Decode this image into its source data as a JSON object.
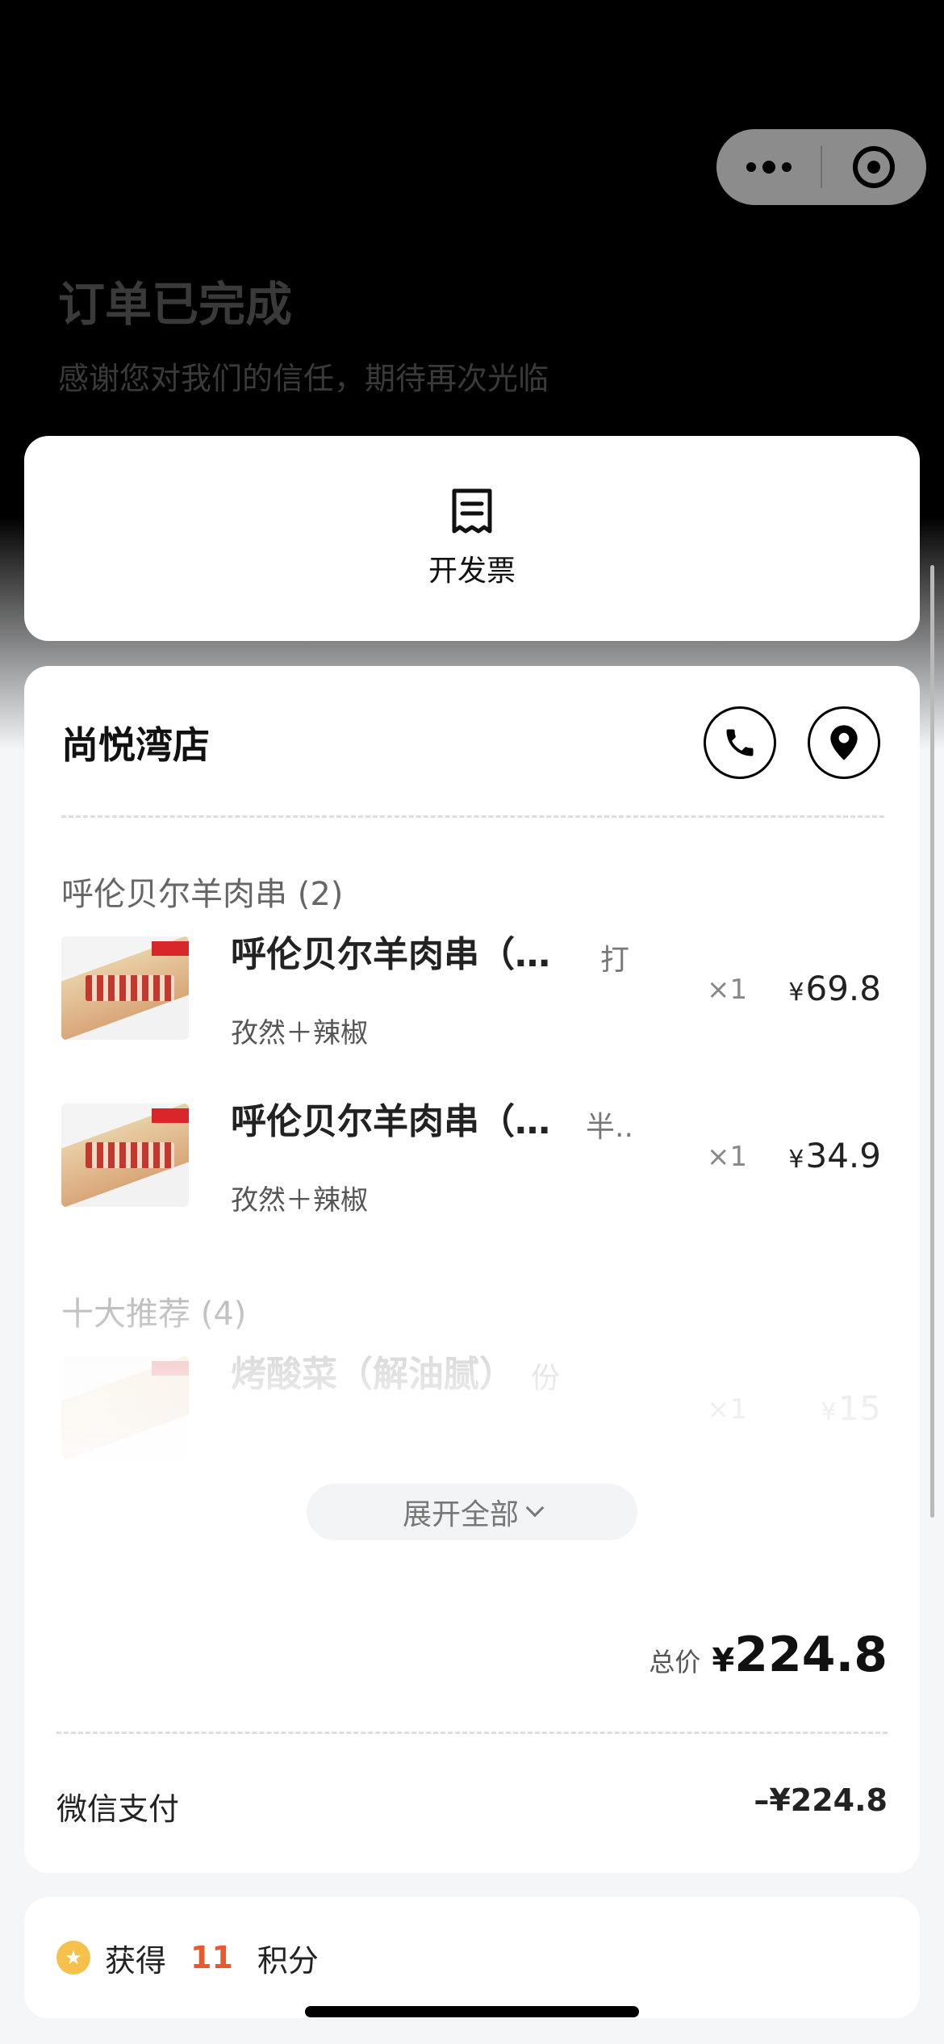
{
  "header": {
    "title": "订单已完成",
    "subtitle": "感谢您对我们的信任，期待再次光临"
  },
  "invoice": {
    "label": "开发票",
    "icon": "receipt-icon"
  },
  "store": {
    "name": "尚悦湾店"
  },
  "groups": [
    {
      "title": "呼伦贝尔羊肉串 (2)",
      "items": [
        {
          "name": "呼伦贝尔羊肉串（…",
          "spec": "打",
          "options": "孜然＋辣椒",
          "qty": "×1",
          "currency": "¥",
          "price": "69.8"
        },
        {
          "name": "呼伦贝尔羊肉串（…",
          "spec": "半..",
          "options": "孜然＋辣椒",
          "qty": "×1",
          "currency": "¥",
          "price": "34.9"
        }
      ]
    },
    {
      "title": "十大推荐 (4)",
      "items": [
        {
          "name": "烤酸菜（解油腻）",
          "spec": "份",
          "qty": "×1",
          "currency": "¥",
          "price": "15"
        }
      ]
    }
  ],
  "expand_label": "展开全部",
  "total": {
    "label": "总价",
    "currency": "¥",
    "value": "224.8"
  },
  "payment": {
    "method": "微信支付",
    "amount": "–¥224.8"
  },
  "points": {
    "prefix": "获得",
    "value": "11",
    "suffix": "积分"
  },
  "colors": {
    "accent": "#e8592e",
    "star": "#f6c14b"
  }
}
